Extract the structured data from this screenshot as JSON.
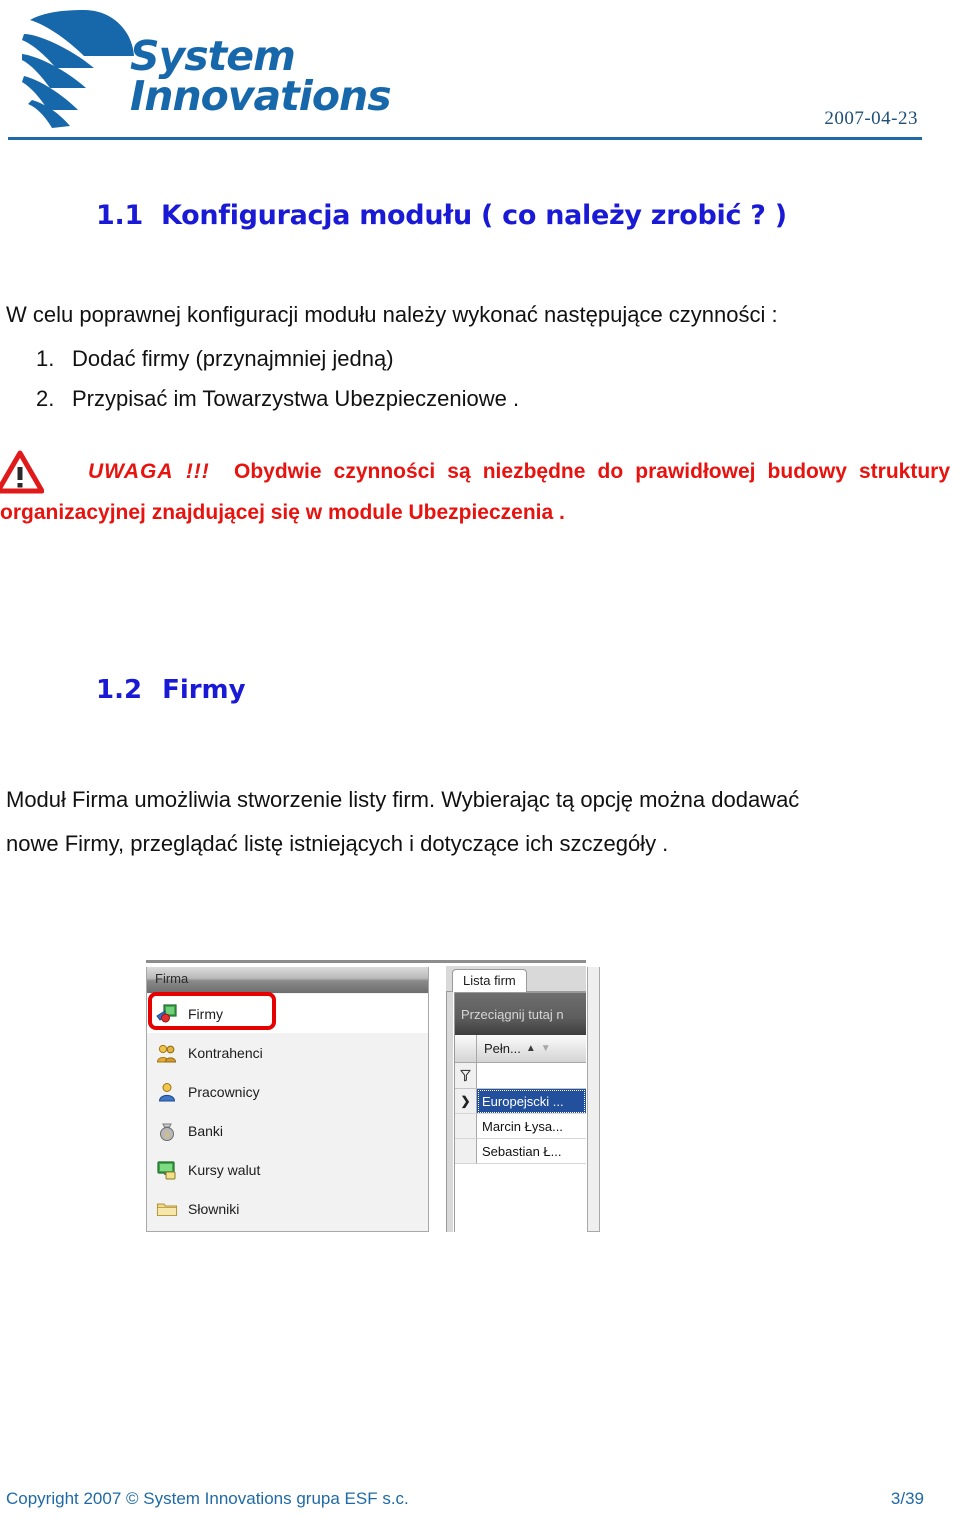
{
  "header": {
    "logo_line1": "System",
    "logo_line2": "Innovations",
    "logo_icon": "globe-stripes-logo",
    "date": "2007-04-23"
  },
  "section_1_1": {
    "number": "1.1",
    "title": "Konfiguracja modułu ( co należy zrobić ? )",
    "intro": "W celu poprawnej konfiguracji modułu należy wykonać następujące czynności :",
    "steps": [
      {
        "marker": "1.",
        "text": "Dodać firmy (przynajmniej jedną)"
      },
      {
        "marker": "2.",
        "text": "Przypisać im Towarzystwa Ubezpieczeniowe ."
      }
    ],
    "warning": {
      "icon": "warning-triangle-icon",
      "label": "UWAGA !!!",
      "text": "Obydwie czynności są niezbędne do prawidłowej budowy struktury organizacyjnej znajdującej się w module Ubezpieczenia .",
      "color": "#e8120e"
    }
  },
  "section_1_2": {
    "number": "1.2",
    "title": "Firmy",
    "paragraph_line1": "Moduł Firma umożliwia stworzenie listy firm. Wybierając tą opcję można dodawać",
    "paragraph_line2": "nowe  Firmy, przeglądać listę istniejących i dotyczące ich szczegóły ."
  },
  "app_screenshot": {
    "nav_panel": {
      "header_label": "Firma",
      "items": [
        {
          "label": "Firmy",
          "icon": "firms-icon",
          "selected": true
        },
        {
          "label": "Kontrahenci",
          "icon": "contractors-people-icon",
          "selected": false
        },
        {
          "label": "Pracownicy",
          "icon": "employee-person-icon",
          "selected": false
        },
        {
          "label": "Banki",
          "icon": "money-bag-icon",
          "selected": false
        },
        {
          "label": "Kursy walut",
          "icon": "currency-monitor-icon",
          "selected": false
        },
        {
          "label": "Słowniki",
          "icon": "folder-icon",
          "selected": false
        }
      ],
      "highlight_color": "#e60000"
    },
    "grid_panel": {
      "tab_label": "Lista firm",
      "group_bar_label": "Przeciągnij tutaj n",
      "column_header": "Pełn...",
      "sort_asc_icon": "sort-ascending-triangle-icon",
      "sort_desc_icon": "sort-descending-triangle-icon",
      "filter_icon": "filter-funnel-icon",
      "row_indicator_icon": "current-row-arrow-icon",
      "rows": [
        {
          "indicator": "❯",
          "value": "Europejscki ...",
          "selected": true
        },
        {
          "indicator": "",
          "value": "Marcin Łysa...",
          "selected": false
        },
        {
          "indicator": "",
          "value": "Sebastian Ł...",
          "selected": false
        }
      ],
      "selection_color": "#23509c"
    }
  },
  "footer": {
    "copyright": "Copyright 2007 © System Innovations grupa ESF s.c.",
    "page": "3/39"
  }
}
